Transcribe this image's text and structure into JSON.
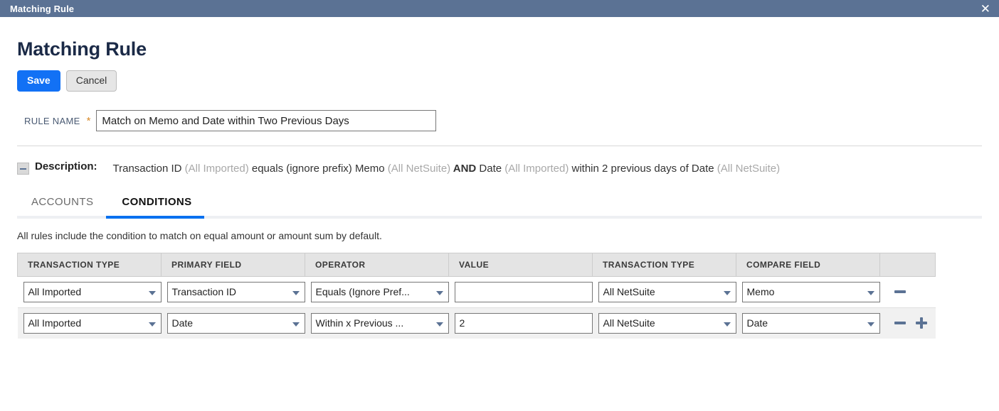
{
  "window": {
    "title": "Matching Rule",
    "close_icon": "close-icon"
  },
  "header": {
    "page_title": "Matching Rule",
    "save_label": "Save",
    "cancel_label": "Cancel",
    "accent_color": "#1271f5",
    "titlebar_color": "#5b7294"
  },
  "rule_name": {
    "label": "RULE NAME",
    "required_marker": "*",
    "value": "Match on Memo and Date within Two Previous Days",
    "placeholder": ""
  },
  "description": {
    "label": "Description:",
    "toggle_icon": "minus-collapse-icon",
    "parts": [
      {
        "text": "Transaction ID ",
        "style": "normal"
      },
      {
        "text": "(All Imported)",
        "style": "muted"
      },
      {
        "text": " equals (ignore prefix) Memo ",
        "style": "normal"
      },
      {
        "text": "(All NetSuite)",
        "style": "muted"
      },
      {
        "text": " AND",
        "style": "strong"
      },
      {
        "text": " Date ",
        "style": "normal"
      },
      {
        "text": "(All Imported)",
        "style": "muted"
      },
      {
        "text": " within 2 previous days of Date ",
        "style": "normal"
      },
      {
        "text": "(All NetSuite)",
        "style": "muted"
      }
    ],
    "seg1": "Transaction ID ",
    "seg2": "(All Imported)",
    "seg3": " equals (ignore prefix) Memo ",
    "seg4": "(All NetSuite)",
    "seg5": " AND",
    "seg6": " Date ",
    "seg7": "(All Imported)",
    "seg8": " within 2 previous days of Date ",
    "seg9": "(All NetSuite)"
  },
  "tabs": {
    "items": [
      {
        "label": "ACCOUNTS",
        "active": false
      },
      {
        "label": "CONDITIONS",
        "active": true
      }
    ],
    "active_color": "#0070f0"
  },
  "conditions": {
    "helper_text": "All rules include the condition to match on equal amount or amount sum by default.",
    "columns": [
      "TRANSACTION TYPE",
      "PRIMARY FIELD",
      "OPERATOR",
      "VALUE",
      "TRANSACTION TYPE",
      "COMPARE FIELD",
      ""
    ],
    "rows": [
      {
        "transaction_type": "All Imported",
        "primary_field": "Transaction ID",
        "operator": "Equals (Ignore Pref...",
        "value": "",
        "compare_transaction_type": "All NetSuite",
        "compare_field": "Memo",
        "has_remove": true,
        "has_add": false
      },
      {
        "transaction_type": "All Imported",
        "primary_field": "Date",
        "operator": "Within x Previous ...",
        "value": "2",
        "compare_transaction_type": "All NetSuite",
        "compare_field": "Date",
        "has_remove": true,
        "has_add": true
      }
    ]
  }
}
